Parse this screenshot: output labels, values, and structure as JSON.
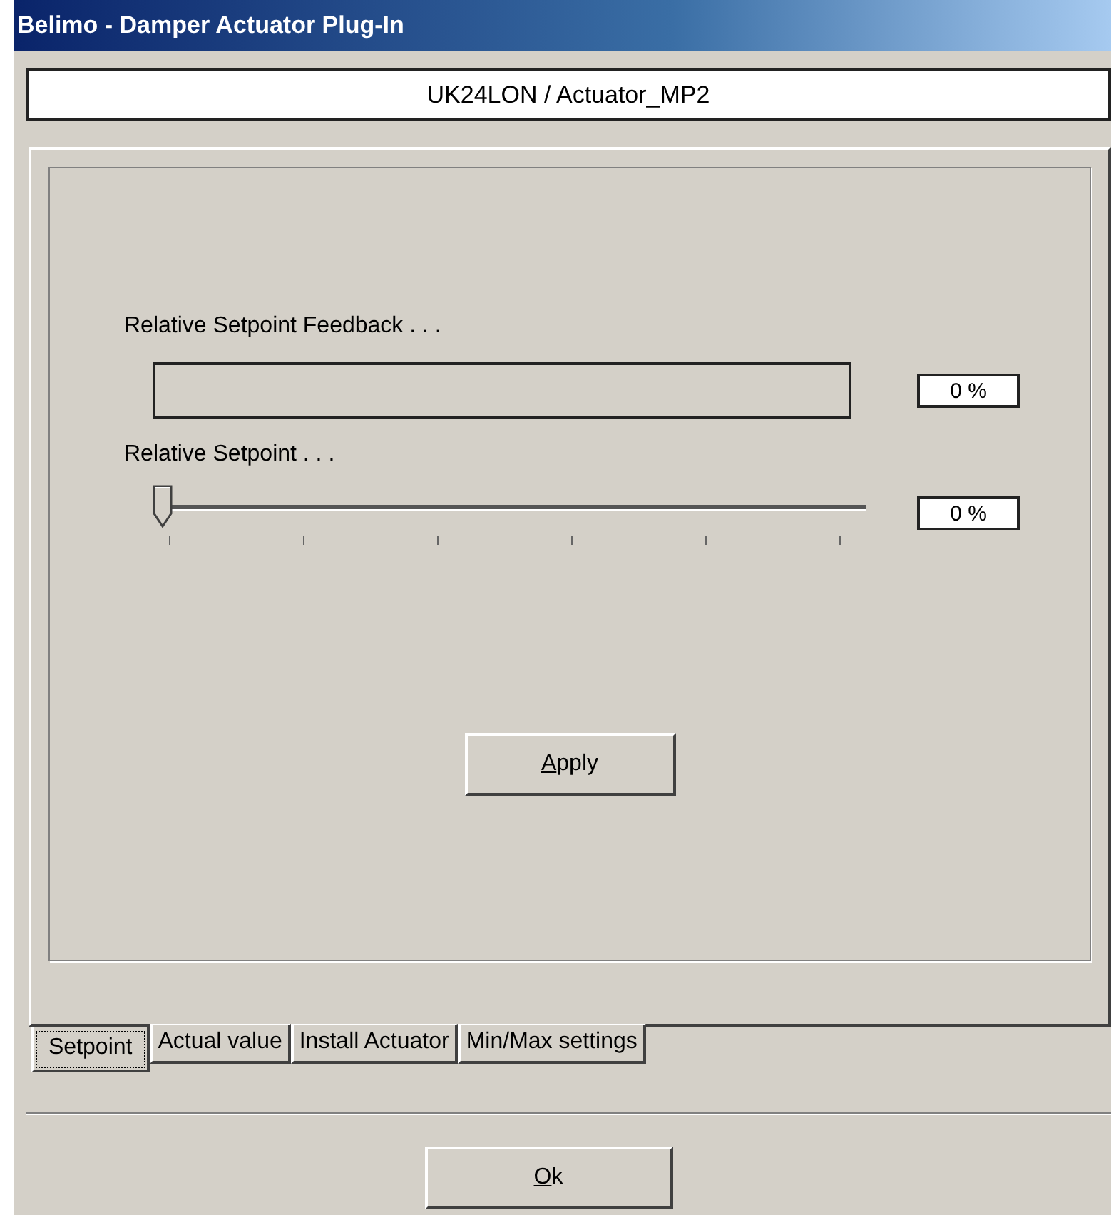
{
  "window": {
    "title": "Belimo - Damper Actuator Plug-In"
  },
  "device_path": "UK24LON / Actuator_MP2",
  "feedback": {
    "label": "Relative Setpoint Feedback . . .",
    "level": 0,
    "reading": "0 %"
  },
  "setpoint": {
    "label": "Relative Setpoint . . .",
    "level": 0,
    "reading": "0 %"
  },
  "apply_button": {
    "access_key": "A",
    "label_rest": "pply"
  },
  "tabs": [
    {
      "label": "Setpoint",
      "selected": true
    },
    {
      "label": "Actual value",
      "selected": false
    },
    {
      "label": "Install Actuator",
      "selected": false
    },
    {
      "label": "Min/Max settings",
      "selected": false
    }
  ],
  "ok_button": {
    "access_key": "O",
    "label_rest": "k"
  }
}
